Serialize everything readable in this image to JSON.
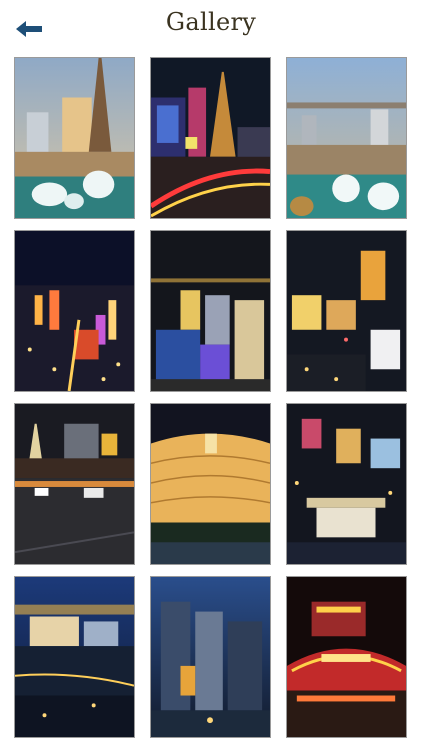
{
  "header": {
    "title": "Gallery",
    "back_icon": "arrow-left-icon"
  },
  "colors": {
    "title_color": "#3a3320",
    "back_icon_color": "#1e4f78"
  },
  "gallery": {
    "tiles": [
      {
        "scene": "paris-las-vegas-day"
      },
      {
        "scene": "strip-night-eiffel"
      },
      {
        "scene": "bellagio-fountains-aerial"
      },
      {
        "scene": "city-night-aerial-1"
      },
      {
        "scene": "city-night-aerial-2"
      },
      {
        "scene": "city-night-aerial-3"
      },
      {
        "scene": "strip-street-night"
      },
      {
        "scene": "bellagio-night"
      },
      {
        "scene": "mirage-night-aerial"
      },
      {
        "scene": "caesars-dusk-aerial"
      },
      {
        "scene": "cosmopolitan-night"
      },
      {
        "scene": "circus-circus-night"
      }
    ]
  }
}
